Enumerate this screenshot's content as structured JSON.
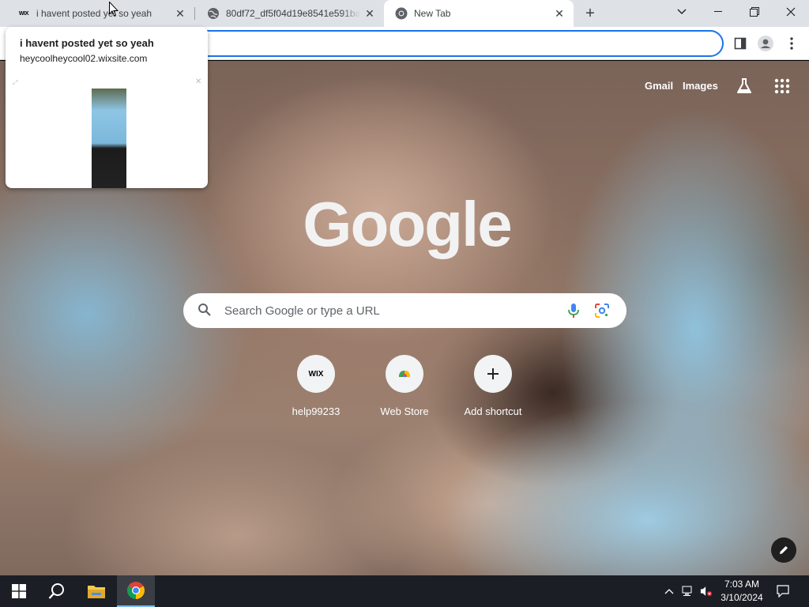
{
  "tabs": [
    {
      "title": "i havent posted yet so yeah",
      "favicon": "wix-icon"
    },
    {
      "title": "80df72_df5f04d19e8541e591ba8",
      "favicon": "globe-icon"
    },
    {
      "title": "New Tab",
      "favicon": "chrome-icon"
    }
  ],
  "toolbar": {
    "address_value": ""
  },
  "ntp": {
    "gmail": "Gmail",
    "images": "Images",
    "logo": "Google",
    "search_placeholder": "Search Google or type a URL",
    "shortcuts": [
      {
        "label": "help99233",
        "icon_text": "WIX"
      },
      {
        "label": "Web Store"
      },
      {
        "label": "Add shortcut"
      }
    ]
  },
  "hovercard": {
    "title": "i havent posted yet so yeah",
    "url": "heycoolheycool02.wixsite.com"
  },
  "taskbar": {
    "time": "7:03 AM",
    "date": "3/10/2024"
  },
  "colors": {
    "accent": "#1a73e8",
    "tabstrip": "#dee1e6",
    "taskbar": "#1b1e24"
  }
}
